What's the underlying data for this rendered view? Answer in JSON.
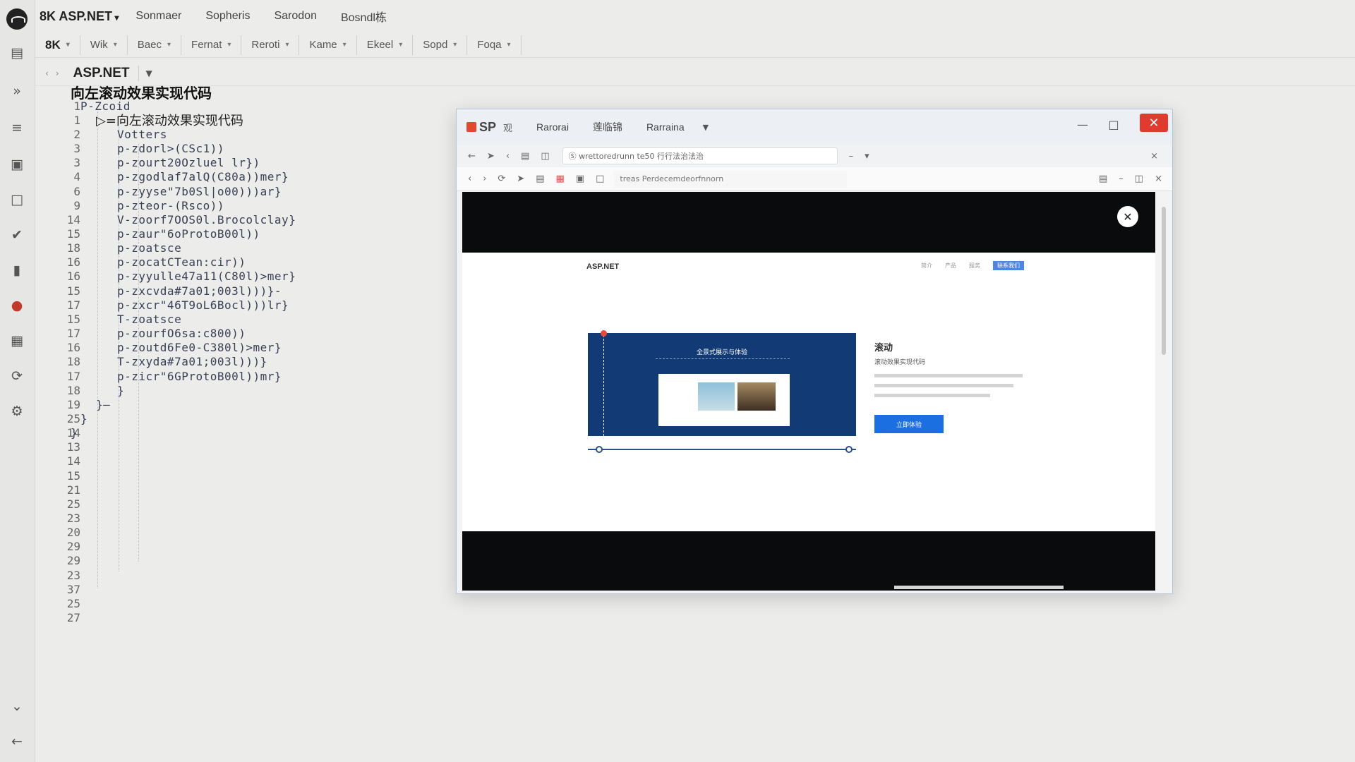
{
  "app": {
    "title": "8K ASP.NET",
    "menus": [
      "Sonmaer",
      "Sopheris",
      "Sarodon",
      "Bosndl栋"
    ]
  },
  "toolbar": [
    {
      "label": "8K"
    },
    {
      "label": "Wik"
    },
    {
      "label": "Baec"
    },
    {
      "label": "Fernat"
    },
    {
      "label": "Reroti"
    },
    {
      "label": "Kame"
    },
    {
      "label": "Ekeel"
    },
    {
      "label": "Sopd"
    },
    {
      "label": "Foqa"
    }
  ],
  "breadcrumb": {
    "file": "ASP.NET"
  },
  "editor": {
    "lines": [
      {
        "n": "1",
        "text": "向左滚动效果实现代码",
        "kind": "title",
        "indent": 0
      },
      {
        "n": "1",
        "text": "P-Zcoid",
        "kind": "code",
        "indent": 1
      },
      {
        "n": "1",
        "text": "▷=向左滚动效果实现代码",
        "kind": "sub",
        "indent": 2
      },
      {
        "n": "2",
        "text": "Votters",
        "kind": "code",
        "indent": 3
      },
      {
        "n": "3",
        "text": "p-zdorl>(CSc1))",
        "kind": "code",
        "indent": 3
      },
      {
        "n": "3",
        "text": "p-zourt20Ozluel lr})",
        "kind": "code",
        "indent": 3
      },
      {
        "n": "4",
        "text": "p-zgodlaf7alQ(C80a))mer}",
        "kind": "code",
        "indent": 3
      },
      {
        "n": "6",
        "text": "p-zyyse\"7b0Sl|o00)))ar}",
        "kind": "code",
        "indent": 3
      },
      {
        "n": "9",
        "text": "p-zteor-(Rsco))",
        "kind": "code",
        "indent": 3
      },
      {
        "n": "14",
        "text": "V-zoorf7OOS0l.Brocolclay}",
        "kind": "code",
        "indent": 3
      },
      {
        "n": "15",
        "text": "p-zaur\"6oProtoB00l))",
        "kind": "code",
        "indent": 3
      },
      {
        "n": "18",
        "text": "p-zoatsce",
        "kind": "code",
        "indent": 3
      },
      {
        "n": "16",
        "text": "p-zocatCTean:cir))",
        "kind": "code",
        "indent": 3
      },
      {
        "n": "16",
        "text": "p-zyyulle47a11(C80l)>mer}",
        "kind": "code",
        "indent": 3
      },
      {
        "n": "15",
        "text": "p-zxcvda#7a01;003l)))}-",
        "kind": "code",
        "indent": 3
      },
      {
        "n": "17",
        "text": "p-zxcr\"46T9oL6Bocl)))lr}",
        "kind": "code",
        "indent": 3
      },
      {
        "n": "15",
        "text": "T-zoatsce",
        "kind": "code",
        "indent": 3
      },
      {
        "n": "17",
        "text": "p-zourfO6sa:c800))",
        "kind": "code",
        "indent": 3
      },
      {
        "n": "16",
        "text": "p-zoutd6Fe0-C380l)>mer}",
        "kind": "code",
        "indent": 3
      },
      {
        "n": "18",
        "text": "T-zxyda#7a01;003l)))}",
        "kind": "code",
        "indent": 3
      },
      {
        "n": "17",
        "text": "p-zicr\"6GProtoB00l))mr}",
        "kind": "code",
        "indent": 3
      },
      {
        "n": "18",
        "text": "}",
        "kind": "code",
        "indent": 3
      },
      {
        "n": "19",
        "text": "}—",
        "kind": "code",
        "indent": 2
      },
      {
        "n": "25",
        "text": "}",
        "kind": "code",
        "indent": 1
      },
      {
        "n": "14",
        "text": "}",
        "kind": "code",
        "indent": 0
      },
      {
        "n": "13",
        "text": "",
        "kind": "code",
        "indent": 0
      },
      {
        "n": "14",
        "text": "",
        "kind": "code",
        "indent": 0
      },
      {
        "n": "15",
        "text": "",
        "kind": "code",
        "indent": 0
      },
      {
        "n": "21",
        "text": "",
        "kind": "code",
        "indent": 0
      },
      {
        "n": "25",
        "text": "",
        "kind": "code",
        "indent": 0
      },
      {
        "n": "23",
        "text": "",
        "kind": "code",
        "indent": 0
      },
      {
        "n": "20",
        "text": "",
        "kind": "code",
        "indent": 0
      },
      {
        "n": "29",
        "text": "",
        "kind": "code",
        "indent": 0
      },
      {
        "n": "29",
        "text": "",
        "kind": "code",
        "indent": 0
      },
      {
        "n": "23",
        "text": "",
        "kind": "code",
        "indent": 0
      },
      {
        "n": "37",
        "text": "",
        "kind": "code",
        "indent": 0
      },
      {
        "n": "25",
        "text": "",
        "kind": "code",
        "indent": 0
      },
      {
        "n": "27",
        "text": "",
        "kind": "code",
        "indent": 0
      }
    ]
  },
  "browser": {
    "logo": "SP",
    "mini": "观",
    "menus": [
      "Rarorai",
      "莲临锦",
      "Rarraina"
    ],
    "address": "Ⓢ  wrettoredrunn   te50   行行法治法治",
    "url": "treas   Perdecemdeorfnnorn",
    "page": {
      "brand": "ASP.NET",
      "nav": [
        "简介",
        "产品",
        "服务"
      ],
      "nav_active": "联系我们",
      "slide_title": "全景式展示与体验",
      "side_title": "滚动",
      "side_sub": "滚动效果实现代码",
      "button": "立即体验"
    }
  },
  "colors": {
    "accent": "#1b6fe0",
    "close": "#e03b2e",
    "slide": "#123a75"
  }
}
